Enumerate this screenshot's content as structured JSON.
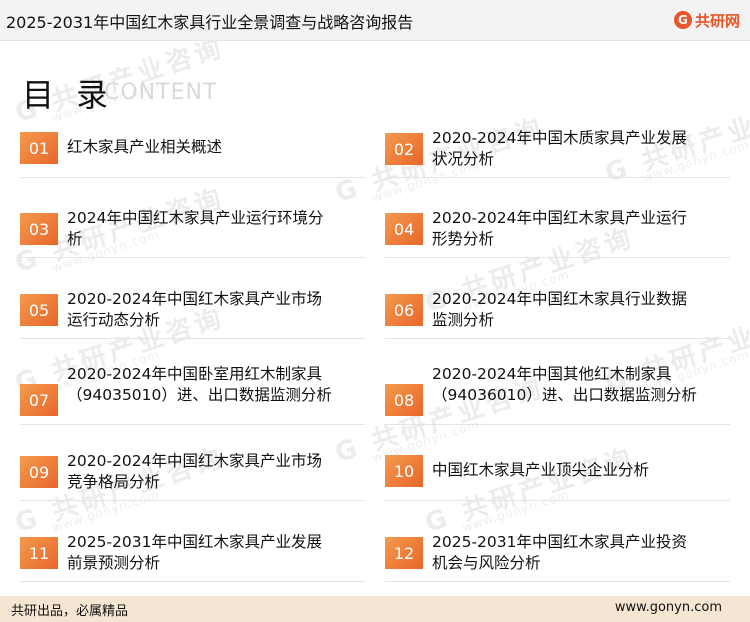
{
  "header": {
    "title": "2025-2031年中国红木家具行业全景调查与战略咨询报告",
    "logo_text": "共研网",
    "logo_mark": "G"
  },
  "toc": {
    "heading": "目 录",
    "subheading": "CONTENT"
  },
  "watermark": {
    "text": "G 共研产业咨询",
    "url": "www.gonyn.com"
  },
  "items": [
    {
      "num": "01",
      "text": "红木家具产业相关概述"
    },
    {
      "num": "02",
      "text": "2020-2024年中国木质家具产业发展状况分析"
    },
    {
      "num": "03",
      "text": "2024年中国红木家具产业运行环境分析"
    },
    {
      "num": "04",
      "text": "2020-2024年中国红木家具产业运行形势分析"
    },
    {
      "num": "05",
      "text": "2020-2024年中国红木家具产业市场运行动态分析"
    },
    {
      "num": "06",
      "text": "2020-2024年中国红木家具行业数据监测分析"
    },
    {
      "num": "07",
      "text": "2020-2024年中国卧室用红木制家具（94035010）进、出口数据监测分析"
    },
    {
      "num": "08",
      "text": "2020-2024年中国其他红木制家具（94036010）进、出口数据监测分析"
    },
    {
      "num": "09",
      "text": "2020-2024年中国红木家具产业市场竞争格局分析"
    },
    {
      "num": "10",
      "text": "中国红木家具产业顶尖企业分析"
    },
    {
      "num": "11",
      "text": "2025-2031年中国红木家具产业发展前景预测分析"
    },
    {
      "num": "12",
      "text": "2025-2031年中国红木家具产业投资机会与风险分析"
    }
  ],
  "footer": {
    "slogan": "共研出品，必属精品",
    "url": "www.gonyn.com"
  },
  "colors": {
    "accent": "#e8662a",
    "accent_light": "#f49a4e",
    "footer_bg": "#f5e6d3",
    "header_bg": "#f3f3f3"
  }
}
